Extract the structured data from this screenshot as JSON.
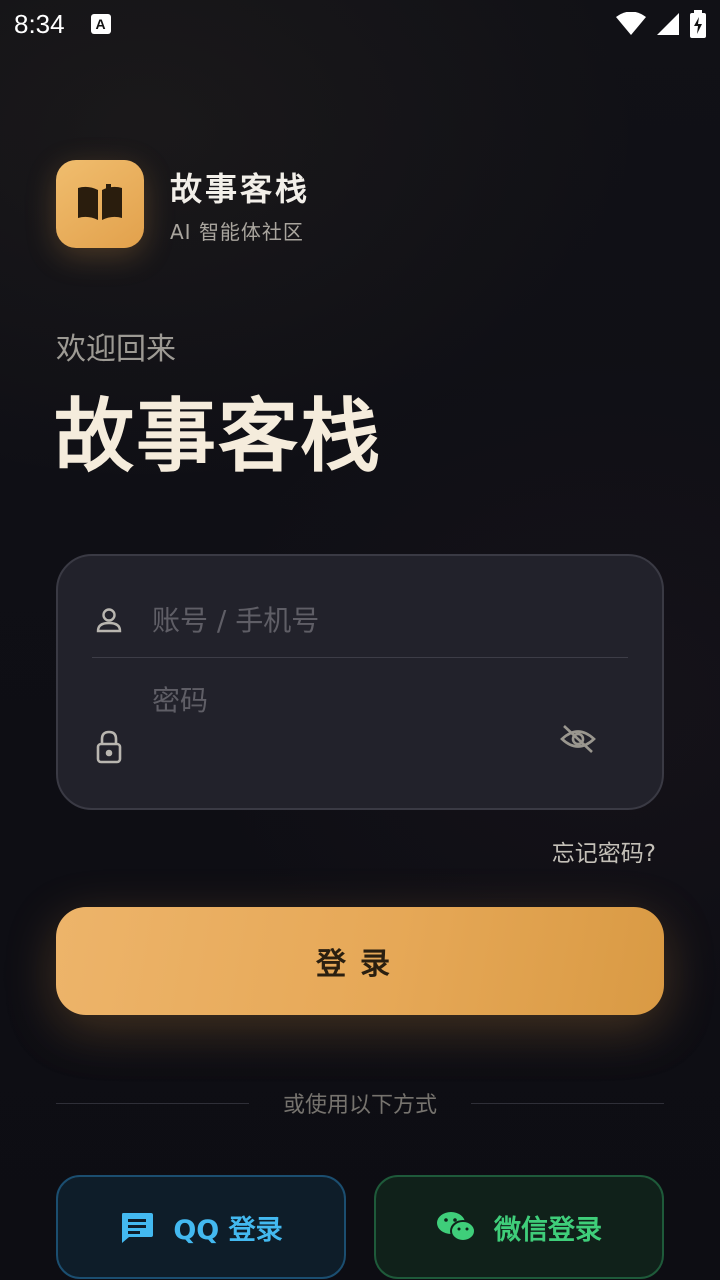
{
  "status_bar": {
    "time": "8:34",
    "notification_icon": "A"
  },
  "brand": {
    "name": "故事客栈",
    "subtitle": "AI 智能体社区",
    "logo_icon": "book-open-icon"
  },
  "welcome_text": "欢迎回来",
  "hero_title": "故事客栈",
  "form": {
    "account_placeholder": "账号 / 手机号",
    "account_value": "",
    "password_placeholder": "密码",
    "password_value": ""
  },
  "forgot_password": "忘记密码?",
  "login_button": "登录",
  "alt_login_text": "或使用以下方式",
  "social": {
    "qq_label": "QQ 登录",
    "wechat_label": "微信登录"
  },
  "colors": {
    "accent": "#e6a857",
    "qq": "#43b9f0",
    "wechat": "#3fce7a",
    "background": "#0e0e14"
  }
}
